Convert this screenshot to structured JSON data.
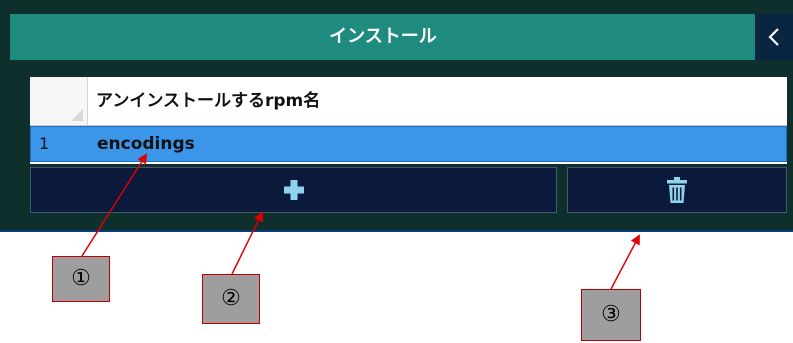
{
  "window": {
    "title": "インストール",
    "collapse_icon": "chevron-left-icon"
  },
  "grid": {
    "column_header": "アンインストールするrpm名",
    "rows": [
      {
        "index": "1",
        "value": "encodings"
      }
    ]
  },
  "buttons": {
    "add_icon": "plus-icon",
    "delete_icon": "trash-icon"
  },
  "callouts": [
    "①",
    "②",
    "③"
  ],
  "colors": {
    "title_bar": "#1f8a7e",
    "selected_row": "#3b95e8",
    "button_bg": "#0b1a3a",
    "icon_cyan": "#8fd3ee",
    "arrow_red": "#e00000"
  }
}
